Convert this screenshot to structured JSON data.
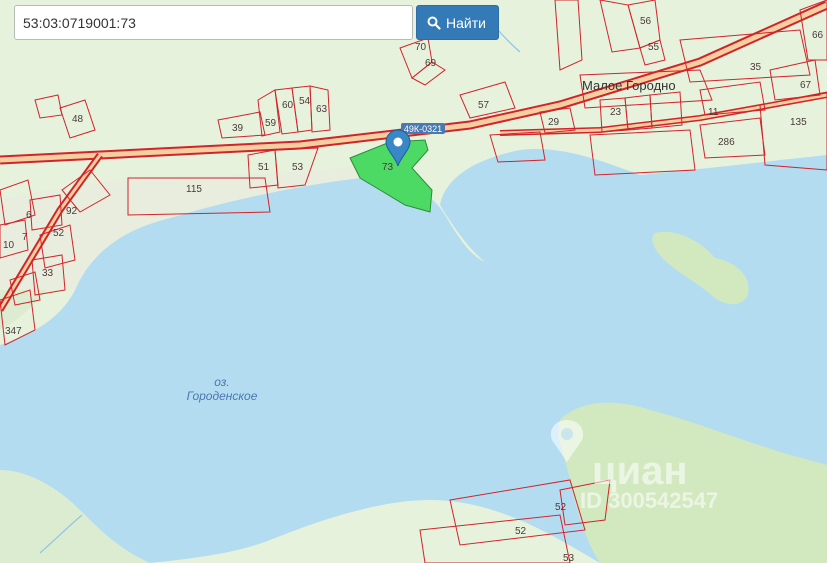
{
  "search": {
    "value": "53:03:0719001:73",
    "button_label": "Найти",
    "button_icon": "search-icon"
  },
  "map": {
    "village_label": "Малое Городно",
    "lake_label_line1": "оз.",
    "lake_label_line2": "Городенское",
    "road_label": "49К-0321",
    "selected_parcel_label": "73",
    "marker_icon": "map-pin-icon",
    "watermark_brand": "циан",
    "watermark_id": "ID 300542547",
    "parcel_labels": [
      "56",
      "55",
      "70",
      "69",
      "35",
      "66",
      "67",
      "57",
      "48",
      "39",
      "59",
      "60",
      "54",
      "63",
      "29",
      "23",
      "11",
      "286",
      "135",
      "51",
      "53",
      "115",
      "6",
      "92",
      "7",
      "10",
      "52",
      "33",
      "347",
      "52",
      "52",
      "53"
    ],
    "colors": {
      "water": "#b4dcf1",
      "land": "#e6f2dc",
      "parcel_border": "#d0242b",
      "selected_parcel": "#4cd964",
      "marker": "#3a87c8",
      "button": "#337ab7"
    }
  }
}
